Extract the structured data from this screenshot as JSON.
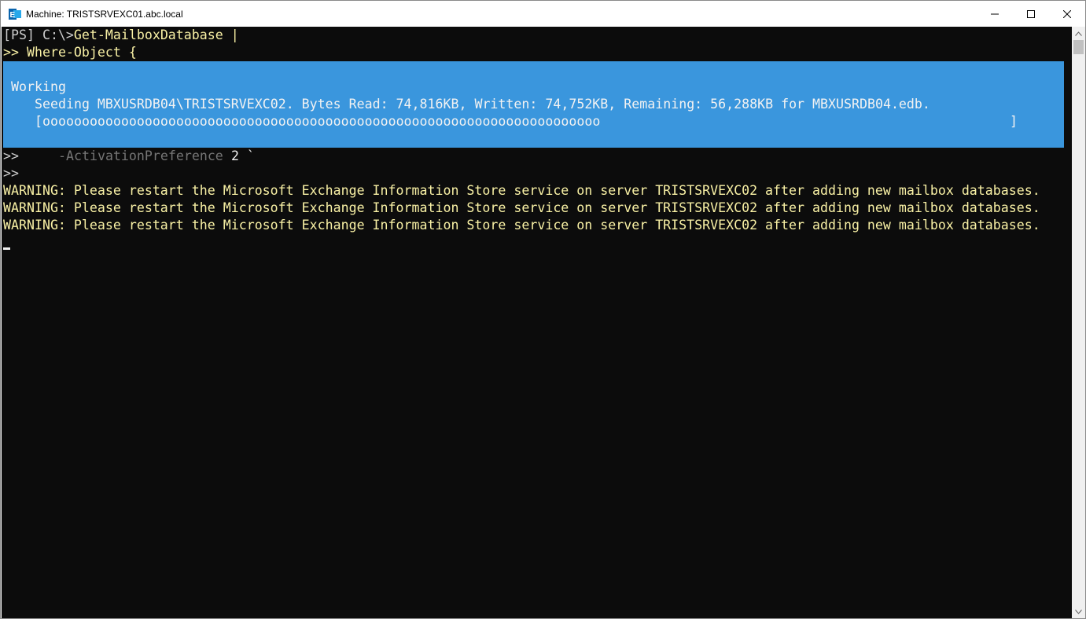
{
  "window": {
    "title": "Machine: TRISTSRVEXC01.abc.local",
    "icon": "exchange-management-shell-icon"
  },
  "console": {
    "lines": [
      {
        "prefix": "[PS] C:\\>",
        "text": "Get-MailboxDatabase |"
      },
      {
        "prefix": ">> ",
        "text": "Where-Object {"
      }
    ],
    "progress": {
      "activity": "Working",
      "status": "Seeding MBXUSRDB04\\TRISTSRVEXC02. Bytes Read: 74,816KB, Written: 74,752KB, Remaining: 56,288KB for MBXUSRDB04.edb.",
      "bar_open": "[",
      "bar_fill": "ooooooooooooooooooooooooooooooooooooooooooooooooooooooooooooooooooooooo",
      "bar_close": "]",
      "percent_complete": 0.57
    },
    "continuation_lines": [
      {
        "prefix": ">>",
        "param": "-ActivationPreference",
        "value": " 2 `"
      },
      {
        "prefix": ">>",
        "param": "",
        "value": ""
      }
    ],
    "warnings": [
      "WARNING: Please restart the Microsoft Exchange Information Store service on server TRISTSRVEXC02 after adding new mailbox databases.",
      "WARNING: Please restart the Microsoft Exchange Information Store service on server TRISTSRVEXC02 after adding new mailbox databases.",
      "WARNING: Please restart the Microsoft Exchange Information Store service on server TRISTSRVEXC02 after adding new mailbox databases."
    ]
  },
  "colors": {
    "console_bg": "#0c0c0c",
    "progress_bg": "#3a96dd",
    "warning_text": "#f9f1a5",
    "prompt_text": "#cccccc"
  }
}
